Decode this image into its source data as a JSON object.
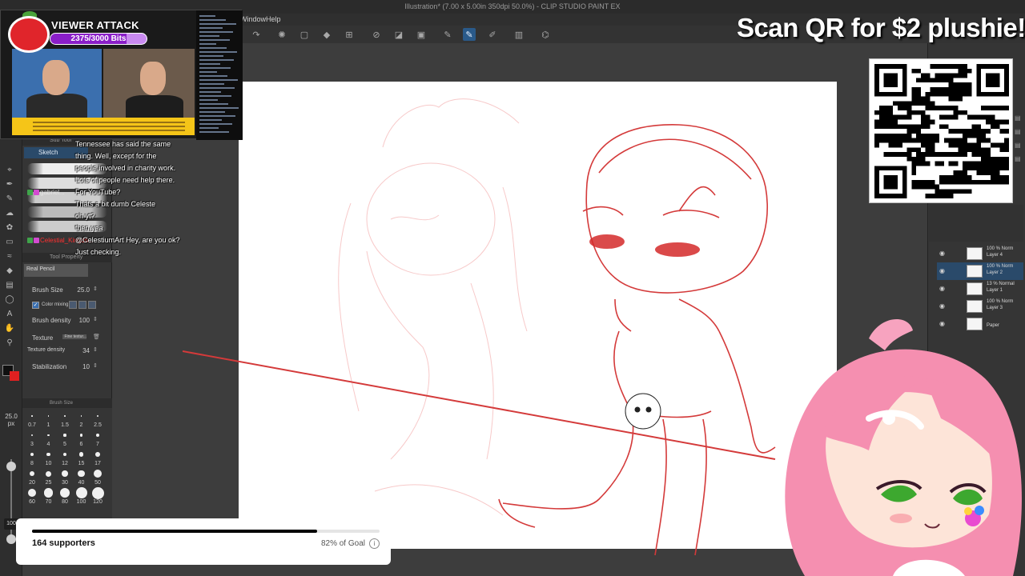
{
  "app": {
    "window_title": "Illustration* (7.00 x 5.00in 350dpi 50.0%) - CLIP STUDIO PAINT EX",
    "menu": [
      {
        "label": "Window"
      },
      {
        "label": "Help"
      }
    ]
  },
  "tool_column": {
    "brush_size_readout": "25.0 px",
    "zoom_readout": "100",
    "colors": {
      "main": "#101010",
      "sub": "#e02020"
    }
  },
  "sub_tool": {
    "header": "Sub Tool",
    "active_group": "Sketch",
    "preset_name": "Real Pencil"
  },
  "tool_property": {
    "header": "Tool Property",
    "rows": [
      {
        "label": "Brush Size",
        "value": "25.0"
      },
      {
        "label": "Color mixing",
        "value": ""
      },
      {
        "label": "Brush density",
        "value": "100"
      },
      {
        "label": "Texture",
        "value": "Fine textur..."
      },
      {
        "label": "Texture density",
        "value": "34"
      },
      {
        "label": "Stabilization",
        "value": "10"
      }
    ]
  },
  "brush_size_panel": {
    "header": "Brush Size",
    "sizes": [
      "0.7",
      "1",
      "1.5",
      "2",
      "2.5",
      "3",
      "4",
      "5",
      "6",
      "7",
      "8",
      "10",
      "12",
      "15",
      "17",
      "20",
      "25",
      "30",
      "40",
      "50",
      "60",
      "70",
      "80",
      "100",
      "120"
    ]
  },
  "layers": [
    {
      "blend": "100 % Norm",
      "name": "Layer 4",
      "selected": false
    },
    {
      "blend": "100 % Norm",
      "name": "Layer 2",
      "selected": true
    },
    {
      "blend": "13 % Normal",
      "name": "Layer 1",
      "selected": false
    },
    {
      "blend": "100 % Norm",
      "name": "Layer 3",
      "selected": false
    },
    {
      "blend": "",
      "name": "Paper",
      "selected": false
    }
  ],
  "stream": {
    "viewer_attack": {
      "title": "VIEWER ATTACK",
      "bits": "2375/3000 Bits",
      "progress": 0.79
    },
    "promo": "Scan QR for $2 plushie!",
    "chat": [
      {
        "user": "",
        "message": "Tennessee has said the same",
        "user_color": "#ffffff"
      },
      {
        "user": "",
        "message": "thing. Well, except for the",
        "user_color": "#ffffff"
      },
      {
        "user": "",
        "message": "people involved in charity work.",
        "user_color": "#ffffff"
      },
      {
        "user": "",
        "message": "Lots of people need help there.",
        "user_color": "#ffffff"
      },
      {
        "user": "gabriel...",
        "message": "For YouTube?",
        "user_color": "#e6e6e6"
      },
      {
        "user": "",
        "message": "Thats a bit dumb Celeste",
        "user_color": "#27c43a"
      },
      {
        "user": "",
        "message": "oh yt?",
        "user_color": "#27c43a"
      },
      {
        "user": "",
        "message": "then yea",
        "user_color": "#27c43a"
      },
      {
        "user": "Celestial_Kingdo...",
        "message": "@CelestiumArt Hey, are you ok?",
        "user_color": "#ff3030"
      },
      {
        "user": "",
        "message": "Just checking.",
        "user_color": "#ff3030"
      }
    ],
    "supporters": {
      "count_label": "164 supporters",
      "goal_label": "82% of Goal",
      "progress": 0.82
    }
  }
}
